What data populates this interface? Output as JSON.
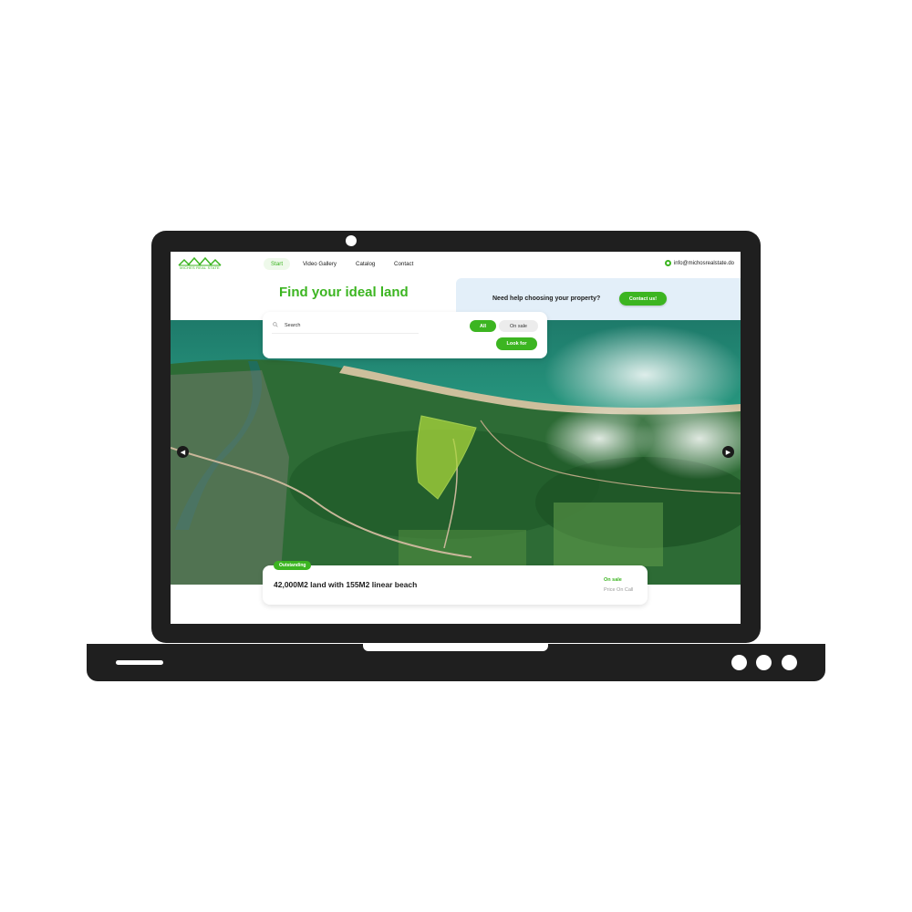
{
  "brand": {
    "logo_text": "MICHES REAL STATE"
  },
  "nav": {
    "items": [
      {
        "label": "Start",
        "active": true
      },
      {
        "label": "Video Gallery",
        "active": false
      },
      {
        "label": "Catalog",
        "active": false
      },
      {
        "label": "Contact",
        "active": false
      }
    ],
    "email": "info@michosrealstate.do"
  },
  "hero": {
    "title": "Find your ideal land"
  },
  "help": {
    "text": "Need help choosing your property?",
    "button": "Contact us!"
  },
  "search": {
    "placeholder": "Search",
    "filters": [
      {
        "label": "All",
        "active": true
      },
      {
        "label": "On sale",
        "active": false
      }
    ],
    "button": "Look for"
  },
  "listing": {
    "badge": "Outstanding",
    "title": "42,000M2 land with 155M2 linear beach",
    "status": "On sale",
    "price": "Price On Call"
  },
  "colors": {
    "accent": "#3cb521",
    "frame": "#1f1f1f",
    "banner": "#e3eff9"
  }
}
